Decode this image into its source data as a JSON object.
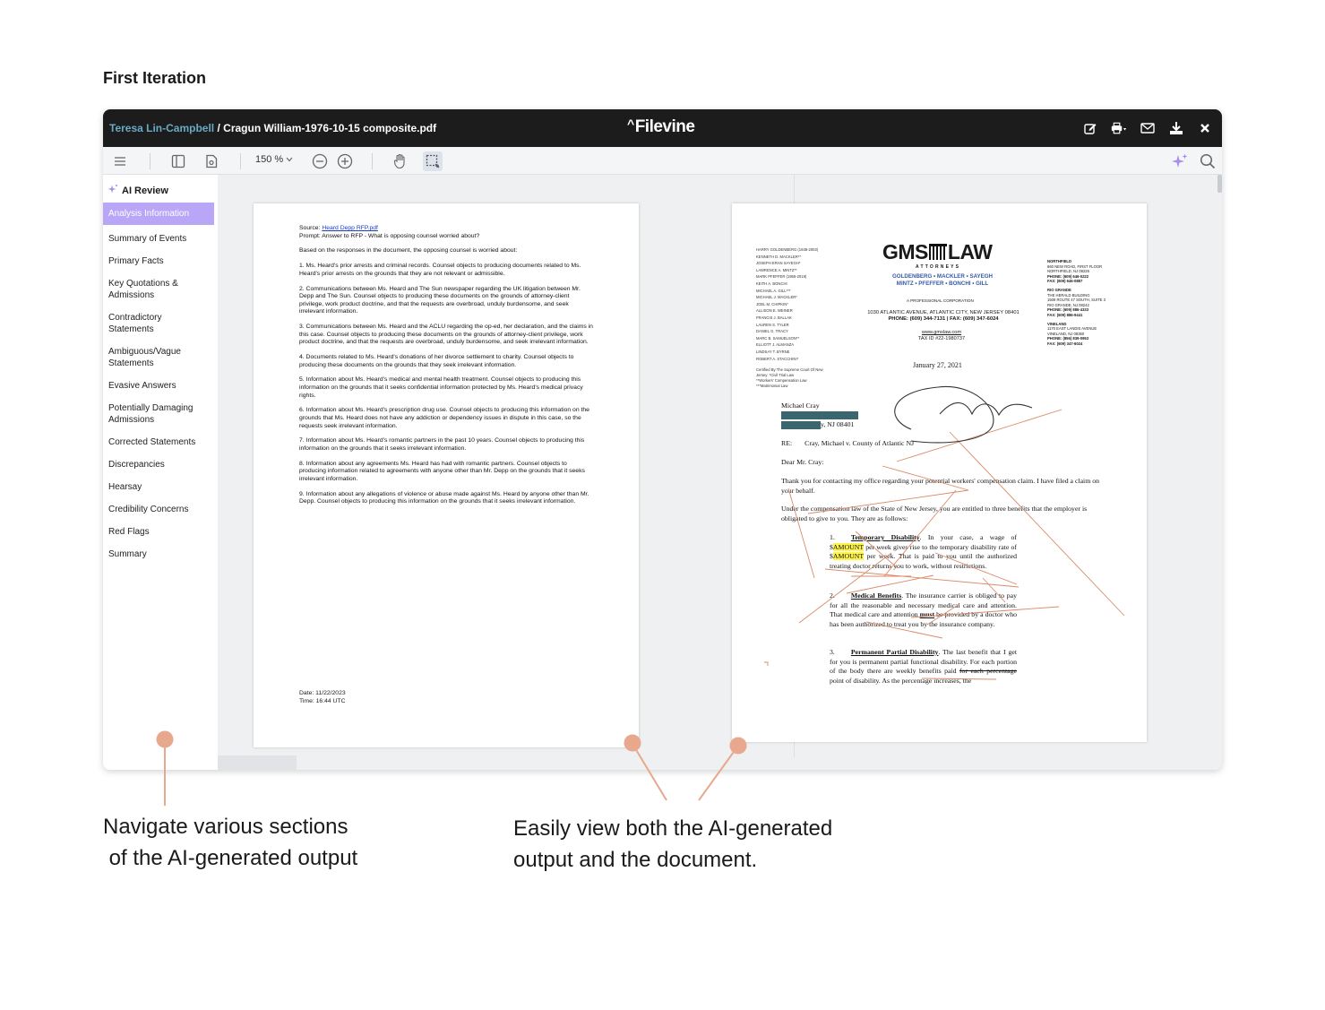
{
  "heading": "First Iteration",
  "titlebar": {
    "client": "Teresa Lin-Campbell",
    "separator": " / ",
    "file": "Cragun William-1976-10-15 composite.pdf",
    "logo": "Filevine"
  },
  "toolbar": {
    "zoom": "150 %"
  },
  "sidebar": {
    "title": "AI Review",
    "items": [
      "Analysis Information",
      "Summary of Events",
      "Primary Facts",
      "Key Quotations & Admissions",
      "Contradictory Statements",
      "Ambiguous/Vague Statements",
      "Evasive Answers",
      "Potentially Damaging Admissions",
      "Corrected Statements",
      "Discrepancies",
      "Hearsay",
      "Credibility Concerns",
      "Red Flags",
      "Summary"
    ]
  },
  "ai_doc": {
    "source_label": "Source: ",
    "source_link": "Heard Depp RFP.pdf",
    "prompt": "Prompt: Answer to RFP - What is opposing counsel worried about?",
    "intro": "Based on the responses in the document, the opposing counsel is worried about:",
    "points": [
      "1. Ms. Heard's prior arrests and criminal records. Counsel objects to producing documents related to Ms. Heard's prior arrests on the grounds that they are not relevant or admissible.",
      "2. Communications between Ms. Heard and The Sun newspaper regarding the UK litigation between Mr. Depp and The Sun. Counsel objects to producing these documents on the grounds of attorney-client privilege, work product doctrine, and that the requests are overbroad, unduly burdensome, and seek irrelevant information.",
      "3. Communications between Ms. Heard and the ACLU regarding the op-ed, her declaration, and the claims in this case. Counsel objects to producing these documents on the grounds of attorney-client privilege, work product doctrine, and that the requests are overbroad, unduly burdensome, and seek irrelevant information.",
      "4. Documents related to Ms. Heard's donations of her divorce settlement to charity. Counsel objects to producing these documents on the grounds that they seek irrelevant information.",
      "5. Information about Ms. Heard's medical and mental health treatment. Counsel objects to producing this information on the grounds that it seeks confidential information protected by Ms. Heard's medical privacy rights.",
      "6. Information about Ms. Heard's prescription drug use. Counsel objects to producing this information on the grounds that Ms. Heard does not have any addiction or dependency issues in dispute in this case, so the requests seek irrelevant information.",
      "7. Information about Ms. Heard's romantic partners in the past 10 years. Counsel objects to producing this information on the grounds that it seeks irrelevant information.",
      "8. Information about any agreements Ms. Heard has had with romantic partners. Counsel objects to producing information related to agreements with anyone other than Mr. Depp on the grounds that it seeks irrelevant information.",
      "9. Information about any allegations of violence or abuse made against Ms. Heard by anyone other than Mr. Depp. Counsel objects to producing this information on the grounds that it seeks irrelevant information."
    ],
    "date": "Date: 11/22/2023",
    "time": "Time: 16:44 UTC"
  },
  "letter": {
    "attorneys": [
      "HARRY GOLDENBERG (1938-2003)",
      "KENNETH D. MACKLER**",
      "JOSEPH ERAN SAYEGH*",
      "LAWRENCE A. MINTZ**",
      "MARK PFEFFER (1955-2019)",
      "KEITH A. BONCHI",
      "MICHAEL A. GILL***",
      "MICHAEL J. MACKLER*",
      "JOEL M. CHIPKIN*",
      "ALLISON E. WEINER",
      "FRANCIS J. BALLAK",
      "LAUREN S. TYLER",
      "DANIEL G. TRACY",
      "MARC B. SAMUELSON**",
      "ELLIOTT J. ALMANZA",
      "LINDSAY T. BYRNE",
      "ROBERT A. STACCHINI*"
    ],
    "certs": [
      "Certified By The Supreme Court Of New",
      "Jersey: *Civil Trial Law",
      "**Workers' Compensation Law",
      "***Matrimonial Law"
    ],
    "logo_left": "GMS",
    "logo_right": "LAW",
    "logo_sub": "ATTORNEYS",
    "firm_line1": "GOLDENBERG • MACKLER • SAYEGH",
    "firm_line2": "MINTZ • PFEFFER • BONCHI • GILL",
    "corp": "A PROFESSIONAL CORPORATION",
    "address": "1030 ATLANTIC AVENUE, ATLANTIC CITY, NEW JERSEY 08401",
    "phone": "PHONE: (609) 344-7131  |  FAX: (609) 347-6024",
    "web": "www.gmslaw.com",
    "tax": "TAX ID #22-1980737",
    "offices": [
      {
        "name": "NORTHFIELD",
        "lines": [
          "660 NEW ROAD, FIRST FLOOR",
          "NORTHFIELD, NJ 08225",
          "PHONE: (609) 646-0222",
          "FAX: (609) 646-0887"
        ]
      },
      {
        "name": "RIO GRANDE",
        "lines": [
          "THE HERALD BUILDING",
          "1508 ROUTE 47 SOUTH, SUITE 3",
          "RIO GRANDE, NJ 08242",
          "PHONE: (609) 886-4333",
          "FAX: (609) 886-9441"
        ]
      },
      {
        "name": "VINELAND",
        "lines": [
          "1170 EAST LANDIS AVENUE",
          "VINELAND, NJ 08360",
          "PHONE: (856) 839-0953",
          "FAX: (609) 347-6024"
        ]
      }
    ],
    "date": "January 27, 2021",
    "recipient": "Michael Cray",
    "recipient_city": "y, NJ 08401",
    "re_label": "RE:",
    "re_text": "Cray, Michael v. County of Atlantic NJ",
    "salutation": "Dear Mr. Cray:",
    "para1": "Thank you for contacting my office regarding your potential workers' compensation claim.  I have filed a claim on your behalf.",
    "para2": "Under the compensation law of the State of New Jersey, you are entitled to three benefits that the employer is obligated to give to you.  They are as follows:",
    "item1_num": "1.",
    "item1_title": "Temporary Disability",
    "item1_a": ".  In your case, a wage of $",
    "amount1": "AMOUNT",
    "item1_b": " per week gives rise to the temporary disability rate of $",
    "amount2": "AMOUNT",
    "item1_c": " per week.  That is paid to you until the authorized treating doctor returns you to work, without restrictions.",
    "item2_num": "2.",
    "item2_title": "Medical Benefits",
    "item2_a": ".  The insurance carrier is obliged to pay for all the reasonable and necessary medical care and attention.  That medical care and attention ",
    "item2_must": "must",
    "item2_b": " be provided by a doctor who has been authorized to treat you by the insurance company.",
    "item3_num": "3.",
    "item3_title": "Permanent Partial Disability",
    "item3_a": ".  The last benefit that I get for you is permanent partial functional disability.  For each portion of the body there are weekly benefits paid ",
    "item3_strike": "for each percentage",
    "item3_b": " point of disability.  As the percentage increases, the"
  },
  "captions": {
    "left_line1": "Navigate various sections",
    "left_line2": " of the AI-generated output",
    "right_line1": "Easily view both the AI-generated",
    "right_line2": "output and the document."
  },
  "colors": {
    "accent": "#b9a6f7",
    "callout": "#e8a88e",
    "titlebar": "#1c1c1c",
    "client_link": "#6aa9c4",
    "redaction": "#3a6670",
    "highlight": "#fff34d",
    "annotation": "#d98a6a"
  }
}
